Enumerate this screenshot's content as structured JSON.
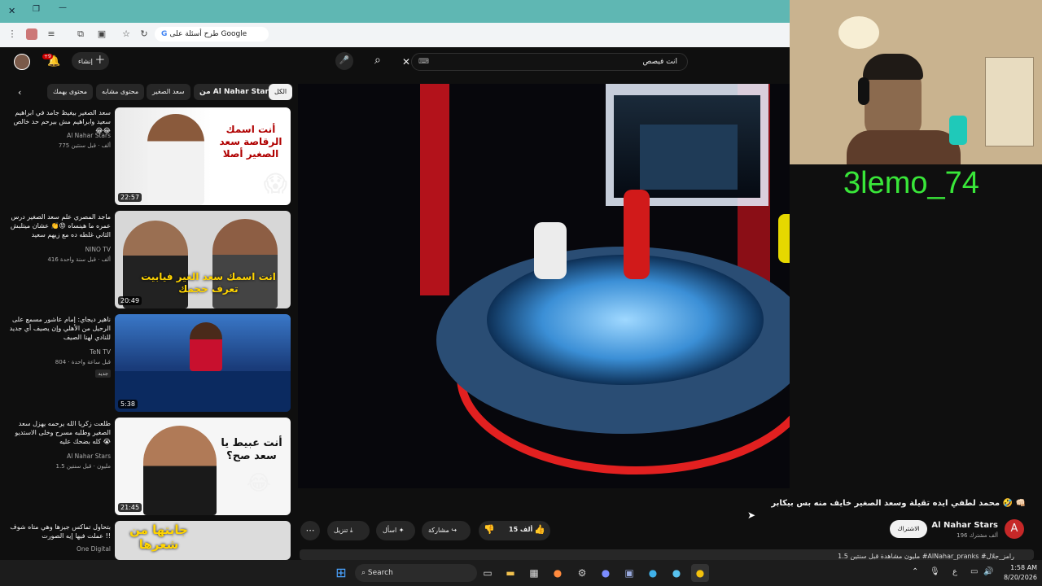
{
  "browser": {
    "omnibox_text": "طرح أسئلة على Google"
  },
  "youtube": {
    "create_label": "إنشاء",
    "notifications_count": "+9",
    "search_value": "انت فيصص",
    "chips": [
      "الكل",
      "من Al Nahar Stars",
      "سعد الصغير",
      "محتوى مشابه",
      "محتوى يهمك"
    ],
    "recommendations": [
      {
        "title": "سعد الصغير بيغيظ جامد في ابراهيم سعيد وابراهيم مش بيرحم حد خالص 😂😂",
        "channel": "Al Nahar Stars",
        "views": "775 ألف",
        "age": "قبل سنتين",
        "duration": "22:57",
        "thumb_text": "أنت اسمك الرقاصة سعد الصغير أصلا"
      },
      {
        "title": "ماجد المصري علم سعد الصغير درس عمره ما هينساه 😡👏 عشان ميتلبش الثاني غلطه ده مع زيهم سعيد",
        "channel": "NINO TV",
        "views": "416 ألف",
        "age": "قبل سنة واحدة",
        "duration": "20:49",
        "thumb_text": "انت اسمك سعد الغير فيابيت تعرف حجمك",
        "brand": "nino"
      },
      {
        "title": "ناهير ديجاي: إمام عاشور مسمع على الرحيل من الأهلي وإن يصيف أي جديد للنادي لهنا الصيف",
        "channel": "TeN TV",
        "views": "804",
        "age": "قبل ساعة واحدة",
        "badge": "جديد",
        "duration": "5:38"
      },
      {
        "title": "طلعت زكريا الله يرحمه يهزل سعد الصغير وطلبه مسرح وخلى الاستديو كله بضحك عليه 😭",
        "channel": "Al Nahar Stars",
        "views": "1.5 مليون",
        "age": "قبل سنتين",
        "duration": "21:45",
        "thumb_text": "أنت عبيط يا سعد صح؟"
      },
      {
        "title": "بتحاول تماكس جيزها وهي متاه شوف عملت فيها إيه الصورت !!",
        "channel": "One Digital",
        "views": "",
        "age": "",
        "duration": "",
        "thumb_text": "جابتها من شعرها"
      }
    ],
    "video": {
      "title": "محمد لطفي ايده تقيلة وسعد الصغير خايف منه بس بيكابر 🤣 👊🏻",
      "channel": "Al Nahar Stars",
      "subscribers": "196 ألف مشترك",
      "subscribe_label": "الاشتراك",
      "likes": "15 ألف",
      "share_label": "مشاركة",
      "ask_label": "اسأل",
      "download_label": "تنزيل",
      "channel_initial": "A",
      "desc_preview": "1.5 مليون مشاهدة قبل سنتين  #AlNahar_pranks #رامز_جلال"
    }
  },
  "webcam": {
    "gamertag": "3lemo_74"
  },
  "taskbar": {
    "search_label": "Search",
    "time": "1:58 AM",
    "date": "8/20/2026",
    "lang": "ع"
  },
  "colors": {
    "accent": "#5fb7b3",
    "gamertag": "#39e639",
    "subscribe_bg": "#f1f1f1",
    "avatar": "#c62828"
  }
}
